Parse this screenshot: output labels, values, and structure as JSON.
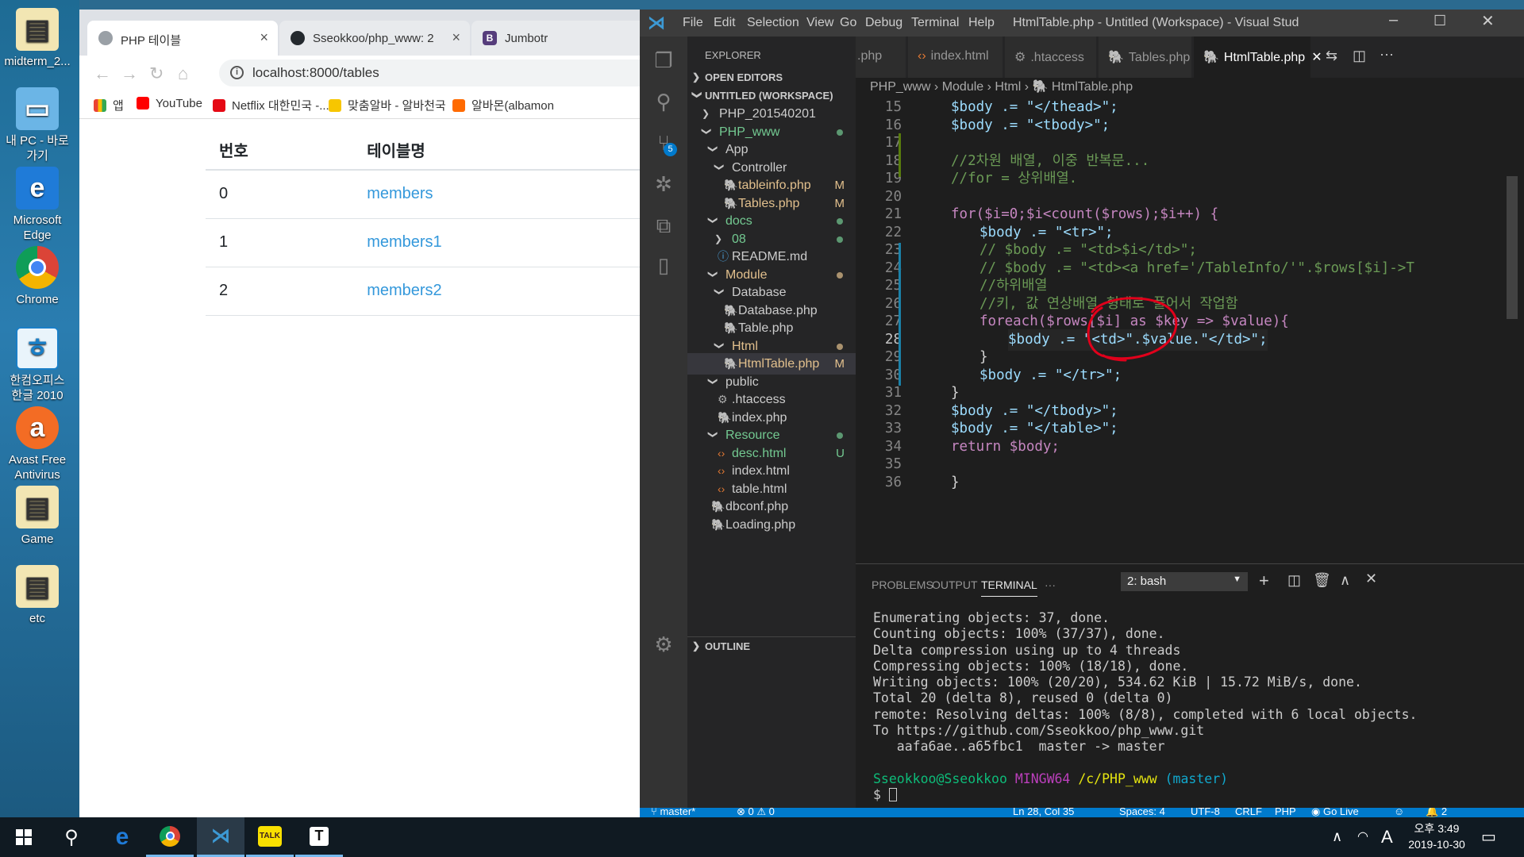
{
  "desktop": {
    "icons": [
      {
        "label": "midterm_2...",
        "icon": "folder-icon"
      },
      {
        "label": "내 PC - 바로 가기",
        "icon": "computer-icon"
      },
      {
        "label": "Microsoft Edge",
        "icon": "edge-icon"
      },
      {
        "label": "Chrome",
        "icon": "chrome-icon"
      },
      {
        "label": "한컴오피스 한글 2010",
        "icon": "hangul-icon"
      },
      {
        "label": "Avast Free Antivirus",
        "icon": "avast-icon"
      },
      {
        "label": "Game",
        "icon": "folder-icon"
      },
      {
        "label": "etc",
        "icon": "folder-icon"
      }
    ]
  },
  "browser": {
    "tabs": [
      {
        "title": "PHP 테이블",
        "active": true
      },
      {
        "title": "Sseokkoo/php_www: 2",
        "active": false
      },
      {
        "title": "Jumbotr",
        "active": false
      }
    ],
    "url": "localhost:8000/tables",
    "bookmarks": [
      "앱",
      "YouTube",
      "Netflix 대한민국 -...",
      "맞춤알바 - 알바천국",
      "알바몬(albamon"
    ],
    "table": {
      "headers": [
        "번호",
        "테이블명"
      ],
      "rows": [
        [
          "0",
          "members"
        ],
        [
          "1",
          "members1"
        ],
        [
          "2",
          "members2"
        ]
      ]
    }
  },
  "vscode": {
    "menu": [
      "File",
      "Edit",
      "Selection",
      "View",
      "Go",
      "Debug",
      "Terminal",
      "Help"
    ],
    "window_title": "HtmlTable.php - Untitled (Workspace) - Visual Studio C...",
    "explorer_title": "EXPLORER",
    "open_editors": "OPEN EDITORS",
    "workspace": "UNTITLED (WORKSPACE)",
    "outline": "OUTLINE",
    "scm_badge": "5",
    "tree": [
      {
        "label": "PHP_201540201",
        "depth": 0,
        "kind": "folder",
        "open": false
      },
      {
        "label": "PHP_www",
        "depth": 0,
        "kind": "folder",
        "open": true,
        "color": "#73c991",
        "dot": true
      },
      {
        "label": "App",
        "depth": 1,
        "kind": "folder",
        "open": true
      },
      {
        "label": "Controller",
        "depth": 2,
        "kind": "folder",
        "open": true
      },
      {
        "label": "tableinfo.php",
        "depth": 3,
        "kind": "php",
        "mark": "M",
        "color": "#e2c08d"
      },
      {
        "label": "Tables.php",
        "depth": 3,
        "kind": "php",
        "mark": "M",
        "color": "#e2c08d"
      },
      {
        "label": "docs",
        "depth": 1,
        "kind": "folder",
        "open": true,
        "color": "#73c991",
        "dot": true
      },
      {
        "label": "08",
        "depth": 2,
        "kind": "folder",
        "open": false,
        "color": "#73c991",
        "dot": true
      },
      {
        "label": "README.md",
        "depth": 2,
        "kind": "info"
      },
      {
        "label": "Module",
        "depth": 1,
        "kind": "folder",
        "open": true,
        "color": "#e2c08d",
        "dot": true
      },
      {
        "label": "Database",
        "depth": 2,
        "kind": "folder",
        "open": true
      },
      {
        "label": "Database.php",
        "depth": 3,
        "kind": "php"
      },
      {
        "label": "Table.php",
        "depth": 3,
        "kind": "php"
      },
      {
        "label": "Html",
        "depth": 2,
        "kind": "folder",
        "open": true,
        "color": "#e2c08d",
        "dot": true
      },
      {
        "label": "HtmlTable.php",
        "depth": 3,
        "kind": "php",
        "mark": "M",
        "color": "#e2c08d",
        "selected": true
      },
      {
        "label": "public",
        "depth": 1,
        "kind": "folder",
        "open": true
      },
      {
        "label": ".htaccess",
        "depth": 2,
        "kind": "gear"
      },
      {
        "label": "index.php",
        "depth": 2,
        "kind": "php"
      },
      {
        "label": "Resource",
        "depth": 1,
        "kind": "folder",
        "open": true,
        "color": "#73c991",
        "dot": true
      },
      {
        "label": "desc.html",
        "depth": 2,
        "kind": "html",
        "mark": "U",
        "color": "#73c991"
      },
      {
        "label": "index.html",
        "depth": 2,
        "kind": "html"
      },
      {
        "label": "table.html",
        "depth": 2,
        "kind": "html"
      },
      {
        "label": "dbconf.php",
        "depth": 1,
        "kind": "php"
      },
      {
        "label": "Loading.php",
        "depth": 1,
        "kind": "php"
      }
    ],
    "editor_tabs": [
      ".php",
      "index.html",
      ".htaccess",
      "Tables.php",
      "HtmlTable.php"
    ],
    "breadcrumb": [
      "PHP_www",
      "Module",
      "Html",
      "HtmlTable.php"
    ],
    "code_lines": [
      {
        "n": "15",
        "t": "$body .= \"</thead>\";"
      },
      {
        "n": "16",
        "t": "$body .= \"<tbody>\";"
      },
      {
        "n": "17",
        "t": ""
      },
      {
        "n": "18",
        "t": "//2차원 배열, 이중 반복문..."
      },
      {
        "n": "19",
        "t": "//for = 상위배열."
      },
      {
        "n": "20",
        "t": ""
      },
      {
        "n": "21",
        "t": "for($i=0;$i<count($rows);$i++) {"
      },
      {
        "n": "22",
        "t": "$body .= \"<tr>\";"
      },
      {
        "n": "23",
        "t": "// $body .= \"<td>$i</td>\";"
      },
      {
        "n": "24",
        "t": "// $body .= \"<td><a href='/TableInfo/'\".$rows[$i]->T"
      },
      {
        "n": "25",
        "t": "//하위배열"
      },
      {
        "n": "26",
        "t": "//키, 값 연상배열 형태로 풀어서 작업함"
      },
      {
        "n": "27",
        "t": "foreach($rows[$i] as $key => $value){"
      },
      {
        "n": "28",
        "t": "$body .= \"<td>\".$value.\"</td>\";"
      },
      {
        "n": "29",
        "t": "}"
      },
      {
        "n": "30",
        "t": "$body .= \"</tr>\";"
      },
      {
        "n": "31",
        "t": "}"
      },
      {
        "n": "32",
        "t": "$body .= \"</tbody>\";"
      },
      {
        "n": "33",
        "t": "$body .= \"</table>\";"
      },
      {
        "n": "34",
        "t": "return $body;"
      },
      {
        "n": "35",
        "t": ""
      },
      {
        "n": "36",
        "t": "}"
      }
    ],
    "panel_tabs": [
      "PROBLEMS",
      "OUTPUT",
      "TERMINAL",
      "···"
    ],
    "terminal_select": "2: bash",
    "terminal_lines": [
      "Enumerating objects: 37, done.",
      "Counting objects: 100% (37/37), done.",
      "Delta compression using up to 4 threads",
      "Compressing objects: 100% (18/18), done.",
      "Writing objects: 100% (20/20), 534.62 KiB | 15.72 MiB/s, done.",
      "Total 20 (delta 8), reused 0 (delta 0)",
      "remote: Resolving deltas: 100% (8/8), completed with 6 local objects.",
      "To https://github.com/Sseokkoo/php_www.git",
      "   aafa6ae..a65fbc1  master -> master",
      ""
    ],
    "prompt": {
      "user": "Sseokkoo@Sseokkoo",
      "shell": "MINGW64",
      "path": "/c/PHP_www",
      "branch": "(master)"
    },
    "status": {
      "branch": "master*",
      "problems": "⊗ 0 ⚠ 0",
      "position": "Ln 28, Col 35",
      "spaces": "Spaces: 4",
      "encoding": "UTF-8",
      "eol": "CRLF",
      "language": "PHP",
      "golive": "Go Live",
      "notifications": "2"
    }
  },
  "taskbar": {
    "time": "오후 3:49",
    "date": "2019-10-30",
    "ime": "A"
  },
  "colors": {
    "accent": "#007acc",
    "link": "#3498db",
    "annotation": "#e0001b"
  }
}
